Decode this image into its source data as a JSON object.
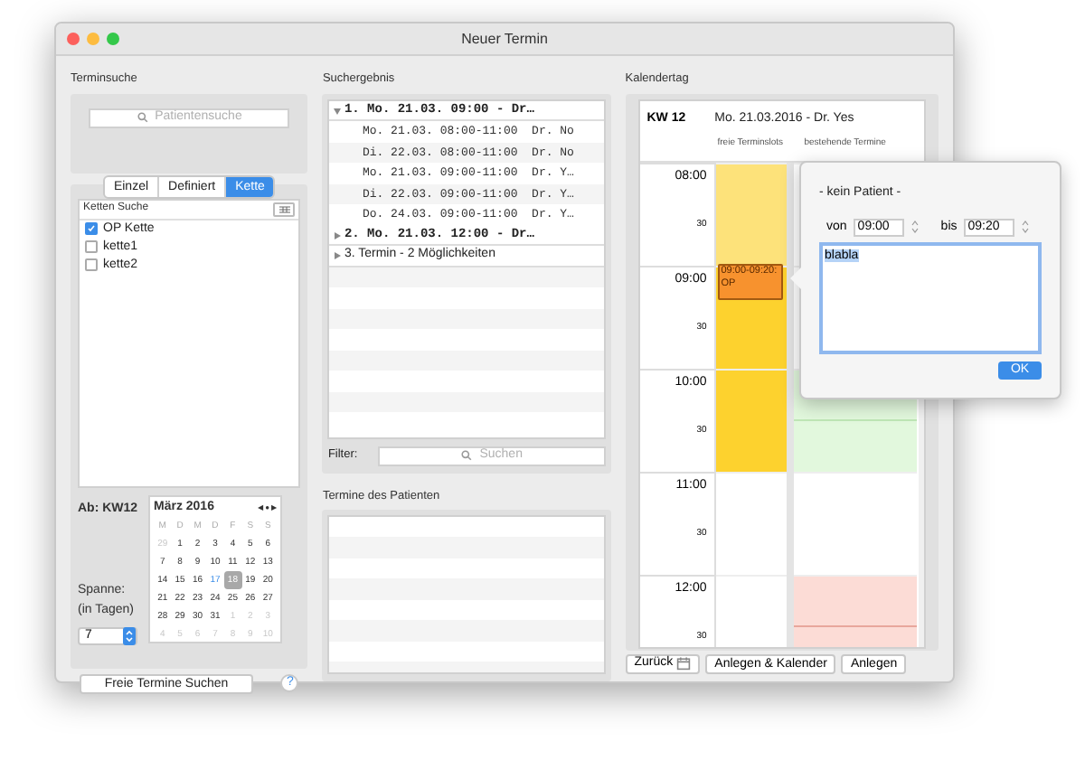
{
  "window": {
    "title": "Neuer Termin"
  },
  "terminsuche": {
    "title": "Terminsuche",
    "search": {
      "placeholder": "Patientensuche"
    },
    "tabs": [
      {
        "label": "Einzel",
        "selected": false
      },
      {
        "label": "Definiert",
        "selected": false
      },
      {
        "label": "Kette",
        "selected": true
      }
    ],
    "list": {
      "header": "Ketten Suche",
      "items": [
        {
          "label": "OP Kette",
          "checked": true
        },
        {
          "label": "kette1",
          "checked": false
        },
        {
          "label": "kette2",
          "checked": false
        }
      ]
    },
    "start_label": "Ab: KW12",
    "calendar": {
      "month": "März 2016",
      "nav": [
        "◀",
        "●",
        "▶"
      ],
      "weekdays": [
        "M",
        "D",
        "M",
        "D",
        "F",
        "S",
        "S"
      ],
      "weeks": [
        [
          {
            "day": "29",
            "kind": "other"
          },
          {
            "day": "1",
            "kind": "normal"
          },
          {
            "day": "2",
            "kind": "normal"
          },
          {
            "day": "3",
            "kind": "normal"
          },
          {
            "day": "4",
            "kind": "normal"
          },
          {
            "day": "5",
            "kind": "normal"
          },
          {
            "day": "6",
            "kind": "normal"
          }
        ],
        [
          {
            "day": "7",
            "kind": "normal"
          },
          {
            "day": "8",
            "kind": "normal"
          },
          {
            "day": "9",
            "kind": "normal"
          },
          {
            "day": "10",
            "kind": "normal"
          },
          {
            "day": "11",
            "kind": "normal"
          },
          {
            "day": "12",
            "kind": "normal"
          },
          {
            "day": "13",
            "kind": "normal"
          }
        ],
        [
          {
            "day": "14",
            "kind": "normal"
          },
          {
            "day": "15",
            "kind": "normal"
          },
          {
            "day": "16",
            "kind": "normal"
          },
          {
            "day": "17",
            "kind": "today"
          },
          {
            "day": "18",
            "kind": "selected"
          },
          {
            "day": "19",
            "kind": "normal"
          },
          {
            "day": "20",
            "kind": "normal"
          }
        ],
        [
          {
            "day": "21",
            "kind": "normal"
          },
          {
            "day": "22",
            "kind": "normal"
          },
          {
            "day": "23",
            "kind": "normal"
          },
          {
            "day": "24",
            "kind": "normal"
          },
          {
            "day": "25",
            "kind": "normal"
          },
          {
            "day": "26",
            "kind": "normal"
          },
          {
            "day": "27",
            "kind": "normal"
          }
        ],
        [
          {
            "day": "28",
            "kind": "normal"
          },
          {
            "day": "29",
            "kind": "normal"
          },
          {
            "day": "30",
            "kind": "normal"
          },
          {
            "day": "31",
            "kind": "normal"
          },
          {
            "day": "1",
            "kind": "other"
          },
          {
            "day": "2",
            "kind": "other"
          },
          {
            "day": "3",
            "kind": "other"
          }
        ],
        [
          {
            "day": "4",
            "kind": "other"
          },
          {
            "day": "5",
            "kind": "other"
          },
          {
            "day": "6",
            "kind": "other"
          },
          {
            "day": "7",
            "kind": "other"
          },
          {
            "day": "8",
            "kind": "other"
          },
          {
            "day": "9",
            "kind": "other"
          },
          {
            "day": "10",
            "kind": "other"
          }
        ]
      ]
    },
    "span_label": "Spanne:\n(in Tagen)",
    "span_value": "7",
    "search_button": "Freie Termine Suchen",
    "help": "?"
  },
  "results": {
    "title": "Suchergebnis",
    "groups": [
      {
        "label": "1. Mo. 21.03. 09:00 - Dr…",
        "kind": "mono",
        "expanded": true,
        "children": [
          "Mo. 21.03. 08:00-11:00  Dr. No",
          "Di. 22.03. 08:00-11:00  Dr. No",
          "Mo. 21.03. 09:00-11:00  Dr. Y…",
          "Di. 22.03. 09:00-11:00  Dr. Y…",
          "Do. 24.03. 09:00-11:00  Dr. Y…"
        ]
      },
      {
        "label": "2. Mo. 21.03. 12:00 - Dr…",
        "kind": "mono",
        "expanded": false
      },
      {
        "label": "3. Termin  -  2 Möglichkeiten",
        "kind": "plain",
        "expanded": false
      }
    ],
    "filter": {
      "label": "Filter:",
      "placeholder": "Suchen"
    }
  },
  "patient_appointments": {
    "title": "Termine des Patienten"
  },
  "calendar_day": {
    "title": "Kalendertag",
    "week": "KW 12",
    "heading": "Mo. 21.03.2016 - Dr. Yes",
    "columns": [
      "freie Terminslots",
      "bestehende Termine"
    ],
    "hours": [
      {
        "time": "08:00",
        "half": "30"
      },
      {
        "time": "09:00",
        "half": "30"
      },
      {
        "time": "10:00",
        "half": "30"
      },
      {
        "time": "11:00",
        "half": "30"
      },
      {
        "time": "12:00",
        "half": "30"
      }
    ],
    "free_column": [
      {
        "kind": "light"
      },
      {
        "kind": "light"
      },
      {
        "kind": "strong",
        "appointment": "09:00-09:20: OP"
      },
      {
        "kind": "strong"
      },
      {
        "kind": "strong"
      },
      {
        "kind": "strong"
      },
      {
        "kind": "none"
      },
      {
        "kind": "none"
      },
      {
        "kind": "none"
      },
      {
        "kind": "none"
      }
    ],
    "existing_column": [
      {
        "kind": "none"
      },
      {
        "kind": "none"
      },
      {
        "kind": "none"
      },
      {
        "kind": "none"
      },
      {
        "kind": "ok"
      },
      {
        "kind": "ok"
      },
      {
        "kind": "none"
      },
      {
        "kind": "none"
      },
      {
        "kind": "busy"
      },
      {
        "kind": "busy"
      }
    ],
    "buttons": [
      "Zurück",
      "Anlegen & Kalender",
      "Anlegen"
    ]
  },
  "popover": {
    "patient": "- kein Patient -",
    "from_label": "von",
    "from": "09:00",
    "to_label": "bis",
    "to": "09:20",
    "note": "blabla",
    "ok": "OK"
  }
}
